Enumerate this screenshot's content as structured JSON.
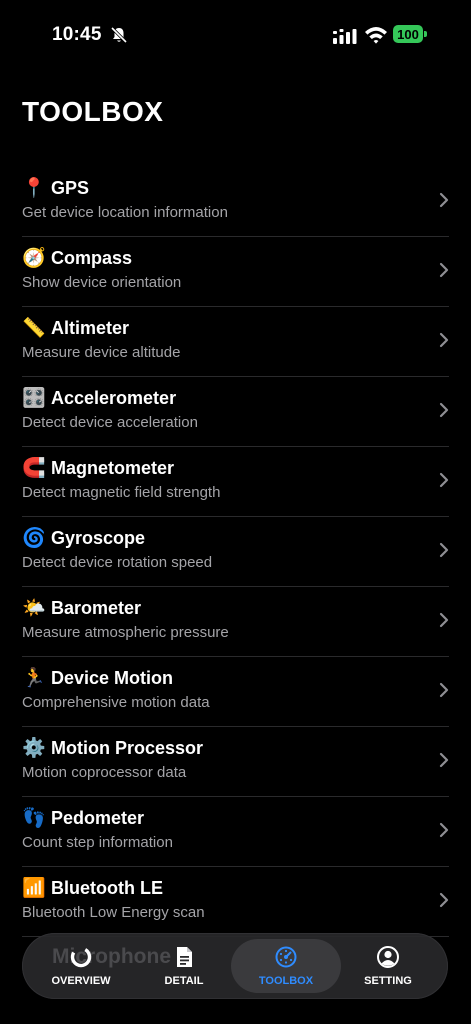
{
  "status_bar": {
    "time": "10:45",
    "battery": "100",
    "battery_color": "#35c759"
  },
  "page": {
    "title": "TOOLBOX"
  },
  "tools": [
    {
      "emoji": "📍",
      "icon": "pin-icon",
      "title": "GPS",
      "subtitle": "Get device location information"
    },
    {
      "emoji": "🧭",
      "icon": "compass-icon",
      "title": "Compass",
      "subtitle": "Show device orientation"
    },
    {
      "emoji": "📏",
      "icon": "ruler-icon",
      "title": "Altimeter",
      "subtitle": "Measure device altitude"
    },
    {
      "emoji": "🎛️",
      "icon": "control-knobs-icon",
      "title": "Accelerometer",
      "subtitle": "Detect device acceleration"
    },
    {
      "emoji": "🧲",
      "icon": "magnet-icon",
      "title": "Magnetometer",
      "subtitle": "Detect magnetic field strength"
    },
    {
      "emoji": "🌀",
      "icon": "cyclone-icon",
      "title": "Gyroscope",
      "subtitle": "Detect device rotation speed"
    },
    {
      "emoji": "🌤️",
      "icon": "sun-cloud-icon",
      "title": "Barometer",
      "subtitle": "Measure atmospheric pressure"
    },
    {
      "emoji": "🏃",
      "icon": "runner-icon",
      "title": "Device Motion",
      "subtitle": "Comprehensive motion data"
    },
    {
      "emoji": "⚙️",
      "icon": "gear-icon",
      "title": "Motion Processor",
      "subtitle": "Motion coprocessor data"
    },
    {
      "emoji": "👣",
      "icon": "footprints-icon",
      "title": "Pedometer",
      "subtitle": "Count step information"
    },
    {
      "emoji": "📶",
      "icon": "signal-bars-icon",
      "title": "Bluetooth LE",
      "subtitle": "Bluetooth Low Energy scan"
    }
  ],
  "partially_hidden_item": {
    "title": "Microphone"
  },
  "tab_bar": {
    "active_color": "#2f8cff",
    "tabs": [
      {
        "label": "OVERVIEW",
        "icon": "overview-ring-icon"
      },
      {
        "label": "DETAIL",
        "icon": "document-icon"
      },
      {
        "label": "TOOLBOX",
        "icon": "toolbox-dial-icon",
        "active": true
      },
      {
        "label": "SETTING",
        "icon": "person-icon"
      }
    ]
  }
}
